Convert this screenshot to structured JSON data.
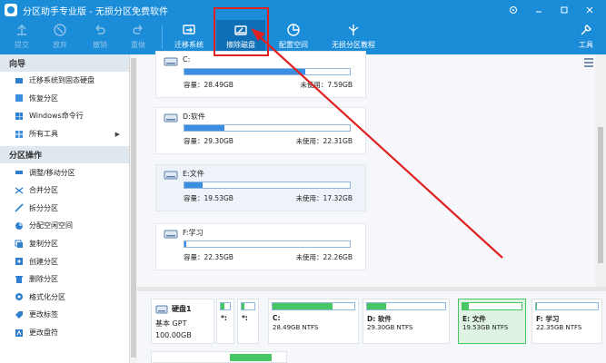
{
  "app": {
    "title": "分区助手专业版 - 无损分区免费软件"
  },
  "window_controls": [
    "share",
    "minimize",
    "restore",
    "close"
  ],
  "toolbar": {
    "buttons": [
      {
        "label": "提交",
        "icon": "upload-icon",
        "enabled": false
      },
      {
        "label": "放弃",
        "icon": "discard-icon",
        "enabled": false
      },
      {
        "label": "撤销",
        "icon": "undo-icon",
        "enabled": false
      },
      {
        "label": "重做",
        "icon": "redo-icon",
        "enabled": false
      },
      {
        "label": "迁移系统",
        "icon": "migrate-icon",
        "enabled": true
      },
      {
        "label": "擦除磁盘",
        "icon": "wipe-disk-icon",
        "enabled": true
      },
      {
        "label": "配置空间",
        "icon": "space-config-icon",
        "enabled": true
      },
      {
        "label": "无损分区教程",
        "icon": "tutorial-icon",
        "enabled": true
      },
      {
        "label": "工具",
        "icon": "tools-icon",
        "enabled": true
      }
    ]
  },
  "sidebar": {
    "sections": [
      {
        "title": "向导",
        "items": [
          {
            "label": "迁移系统到固态硬盘",
            "icon": "migrate-ssd-icon"
          },
          {
            "label": "恢复分区",
            "icon": "recover-icon"
          },
          {
            "label": "Windows命令行",
            "icon": "cmd-icon"
          },
          {
            "label": "所有工具",
            "icon": "all-tools-icon",
            "has_submenu": true
          }
        ]
      },
      {
        "title": "分区操作",
        "items": [
          {
            "label": "调整/移动分区",
            "icon": "resize-icon"
          },
          {
            "label": "合并分区",
            "icon": "merge-icon"
          },
          {
            "label": "拆分分区",
            "icon": "split-icon"
          },
          {
            "label": "分配空闲空间",
            "icon": "allocate-icon"
          },
          {
            "label": "复制分区",
            "icon": "copy-icon"
          },
          {
            "label": "创建分区",
            "icon": "create-icon"
          },
          {
            "label": "删除分区",
            "icon": "delete-icon"
          },
          {
            "label": "格式化分区",
            "icon": "format-icon"
          },
          {
            "label": "更改标签",
            "icon": "label-icon"
          },
          {
            "label": "更改盘符",
            "icon": "letter-icon"
          }
        ]
      }
    ]
  },
  "partitions": [
    {
      "name": "C:",
      "capacity": "容量：28.49GB",
      "free": "未使用：7.59GB",
      "used_fraction": 0.73,
      "selected": false
    },
    {
      "name": "D:软件",
      "capacity": "容量：29.30GB",
      "free": "未使用：22.31GB",
      "used_fraction": 0.24,
      "selected": false
    },
    {
      "name": "E:文件",
      "capacity": "容量：19.53GB",
      "free": "未使用：17.32GB",
      "used_fraction": 0.11,
      "selected": true
    },
    {
      "name": "F:学习",
      "capacity": "容量：22.35GB",
      "free": "未使用：22.26GB",
      "used_fraction": 0.01,
      "selected": false
    }
  ],
  "disk_map": {
    "disk": {
      "name": "硬盘1",
      "type": "基本 GPT",
      "size": "100.00GB"
    },
    "parts": [
      {
        "name": "*:",
        "size": "",
        "used_fraction": 0.35,
        "selected": false
      },
      {
        "name": "*:",
        "size": "",
        "used_fraction": 0.2,
        "selected": false
      },
      {
        "name": "C:",
        "size": "28.49GB NTFS",
        "used_fraction": 0.73,
        "selected": false
      },
      {
        "name": "D: 软件",
        "size": "29.30GB NTFS",
        "used_fraction": 0.24,
        "selected": false
      },
      {
        "name": "E: 文件",
        "size": "19.53GB NTFS",
        "used_fraction": 0.11,
        "selected": true
      },
      {
        "name": "F: 学习",
        "size": "22.35GB NTFS",
        "used_fraction": 0.01,
        "selected": false
      }
    ]
  },
  "colors": {
    "accent": "#1a8cd8",
    "bar_blue": "#3b8de0",
    "bar_green": "#47c764",
    "annotation_red": "#e02020"
  }
}
